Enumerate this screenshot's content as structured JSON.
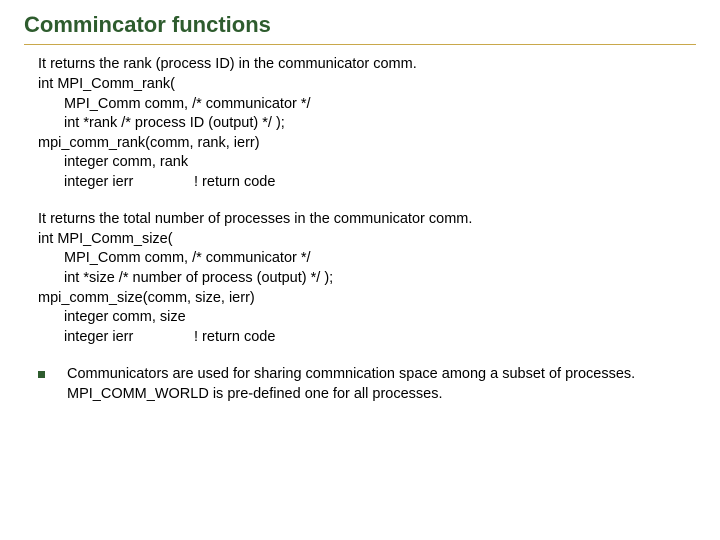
{
  "title": "Commincator functions",
  "rank_block": {
    "desc": "It returns the rank (process ID) in the communicator comm.",
    "c0": "int MPI_Comm_rank(",
    "c1": "MPI_Comm comm, /* communicator */",
    "c2": "int *rank /* process ID (output) */ );",
    "f0": "mpi_comm_rank(comm, rank, ierr)",
    "f1": "integer comm, rank",
    "f2a": "integer ierr",
    "f2b": "! return code"
  },
  "size_block": {
    "desc": "It returns the total number of processes in the communicator comm.",
    "c0": "int MPI_Comm_size(",
    "c1": "MPI_Comm comm, /* communicator */",
    "c2": "int *size /* number of process (output) */ );",
    "f0": "mpi_comm_size(comm, size, ierr)",
    "f1": "integer comm, size",
    "f2a": "integer ierr",
    "f2b": "! return code"
  },
  "bullet1": "Communicators are used for sharing commnication space among a subset of processes. MPI_COMM_WORLD is pre-defined one for all processes."
}
